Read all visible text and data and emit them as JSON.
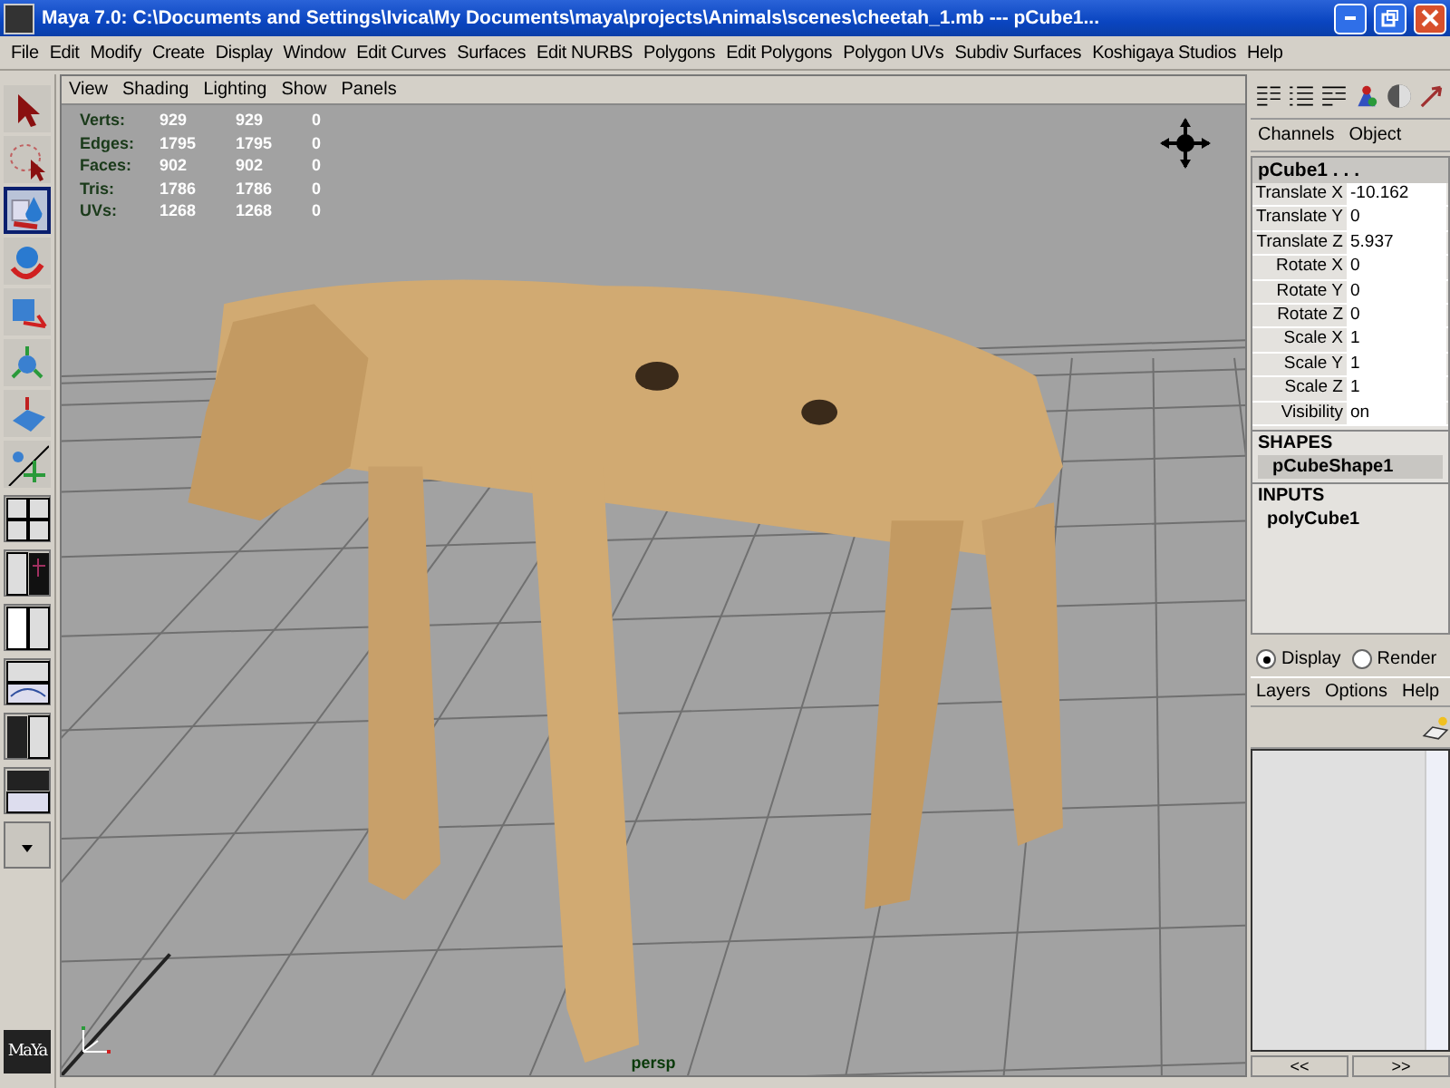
{
  "window": {
    "title": "Maya 7.0: C:\\Documents and Settings\\Ivica\\My Documents\\maya\\projects\\Animals\\scenes\\cheetah_1.mb   ---   pCube1..."
  },
  "menu": [
    "File",
    "Edit",
    "Modify",
    "Create",
    "Display",
    "Window",
    "Edit Curves",
    "Surfaces",
    "Edit NURBS",
    "Polygons",
    "Edit Polygons",
    "Polygon UVs",
    "Subdiv Surfaces",
    "Koshigaya Studios",
    "Help"
  ],
  "tools": [
    {
      "kind": "select",
      "selected": false
    },
    {
      "kind": "lasso",
      "selected": false
    },
    {
      "kind": "paint",
      "selected": true
    },
    {
      "kind": "move",
      "selected": false
    },
    {
      "kind": "rotate",
      "selected": false
    },
    {
      "kind": "scale",
      "selected": false
    },
    {
      "kind": "softmod",
      "selected": false
    },
    {
      "kind": "show",
      "selected": false
    }
  ],
  "viewport": {
    "menu": [
      "View",
      "Shading",
      "Lighting",
      "Show",
      "Panels"
    ],
    "stats": [
      {
        "label": "Verts:",
        "values": [
          "929",
          "929",
          "0"
        ]
      },
      {
        "label": "Edges:",
        "values": [
          "1795",
          "1795",
          "0"
        ]
      },
      {
        "label": "Faces:",
        "values": [
          "902",
          "902",
          "0"
        ]
      },
      {
        "label": "Tris:",
        "values": [
          "1786",
          "1786",
          "0"
        ]
      },
      {
        "label": "UVs:",
        "values": [
          "1268",
          "1268",
          "0"
        ]
      }
    ],
    "camera": "persp"
  },
  "channel_box": {
    "tabs": [
      "Channels",
      "Object"
    ],
    "object": "pCube1 . . .",
    "channels": [
      {
        "name": "Translate X",
        "value": "-10.162"
      },
      {
        "name": "Translate Y",
        "value": "0"
      },
      {
        "name": "Translate Z",
        "value": "5.937"
      },
      {
        "name": "Rotate X",
        "value": "0"
      },
      {
        "name": "Rotate Y",
        "value": "0"
      },
      {
        "name": "Rotate Z",
        "value": "0"
      },
      {
        "name": "Scale X",
        "value": "1"
      },
      {
        "name": "Scale Y",
        "value": "1"
      },
      {
        "name": "Scale Z",
        "value": "1"
      },
      {
        "name": "Visibility",
        "value": "on"
      }
    ],
    "shapes_header": "SHAPES",
    "shapes": [
      "pCubeShape1"
    ],
    "inputs_header": "INPUTS",
    "inputs": [
      "polyCube1"
    ]
  },
  "layer_editor": {
    "modes": [
      {
        "label": "Display",
        "selected": true
      },
      {
        "label": "Render",
        "selected": false
      }
    ],
    "menu": [
      "Layers",
      "Options",
      "Help"
    ],
    "pager": [
      "<<",
      ">>"
    ]
  },
  "logo": "MaYa"
}
